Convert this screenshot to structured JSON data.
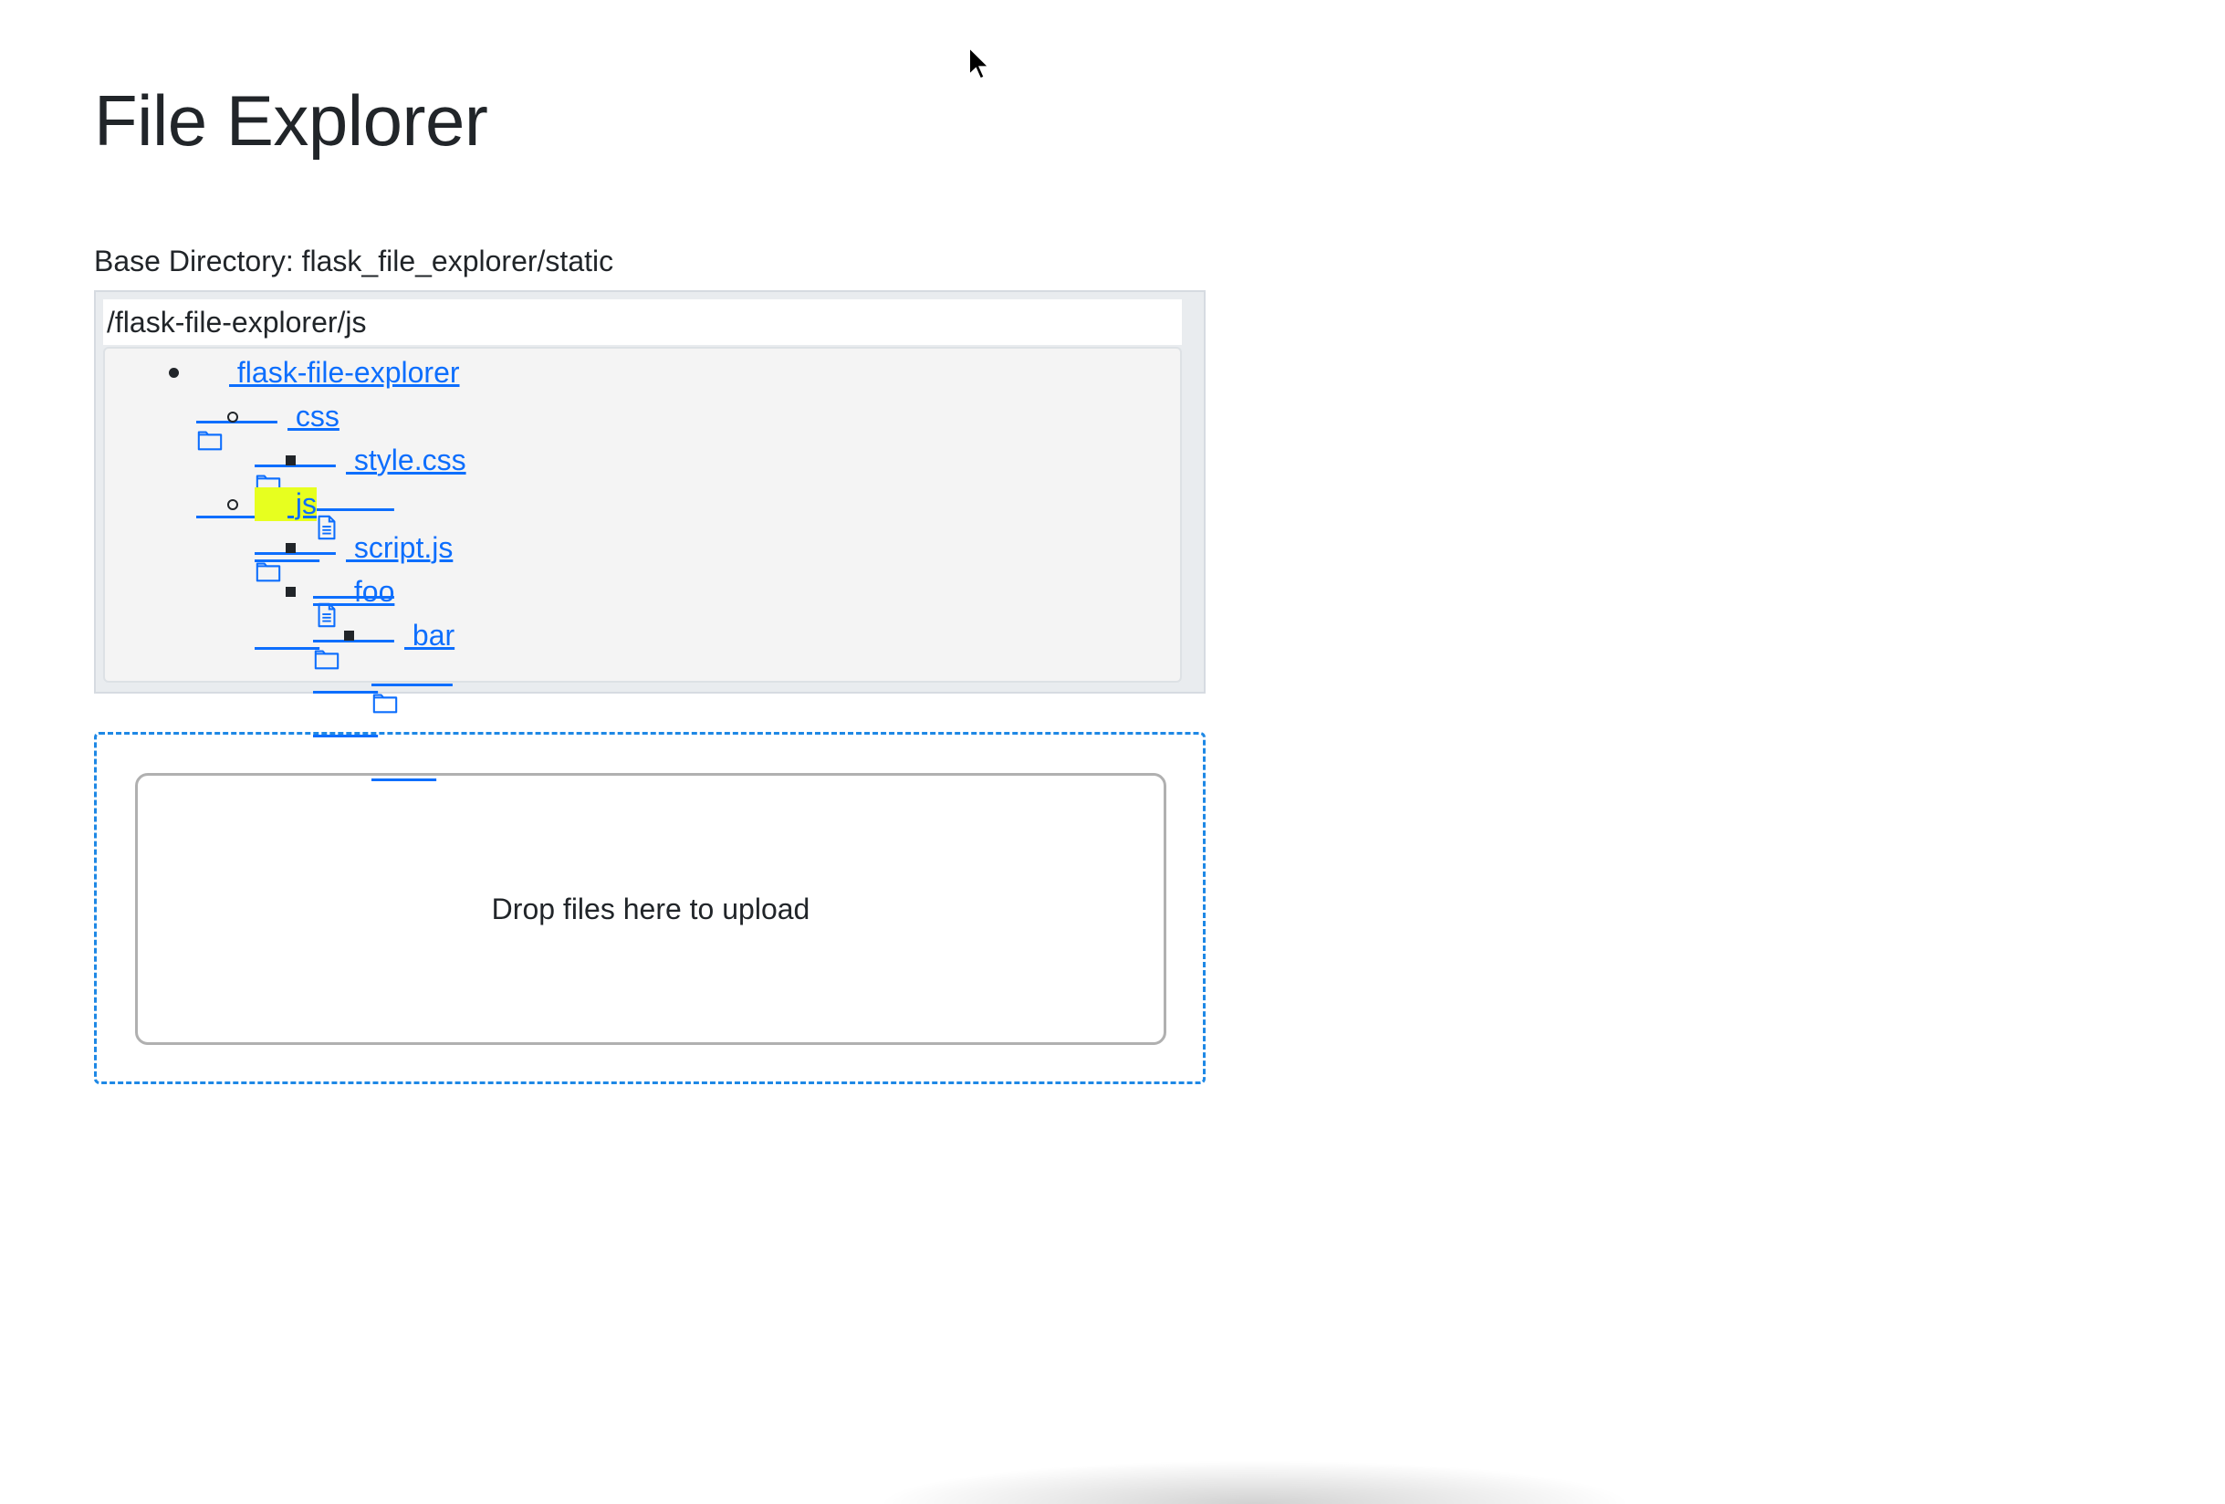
{
  "page": {
    "title": "File Explorer",
    "base_directory": "Base Directory: flask_file_explorer/static"
  },
  "explorer": {
    "current_path": "/flask-file-explorer/js",
    "tree": [
      {
        "label": " flask-file-explorer",
        "type": "folder",
        "bullet": "disc",
        "selected": false
      },
      {
        "label": " css",
        "type": "folder",
        "bullet": "circle",
        "selected": false
      },
      {
        "label": " style.css",
        "type": "file",
        "bullet": "square",
        "selected": false
      },
      {
        "label": " js",
        "type": "folder",
        "bullet": "circle",
        "selected": true
      },
      {
        "label": " script.js",
        "type": "file",
        "bullet": "square",
        "selected": false
      },
      {
        "label": " foo",
        "type": "folder",
        "bullet": "square",
        "selected": false
      },
      {
        "label": " bar",
        "type": "folder",
        "bullet": "square",
        "selected": false
      }
    ],
    "highlight_color": "#e7ff1f",
    "link_color": "#0d6efd"
  },
  "upload": {
    "prompt": "Drop files here to upload",
    "dashed_border_color": "#1e88e5"
  }
}
